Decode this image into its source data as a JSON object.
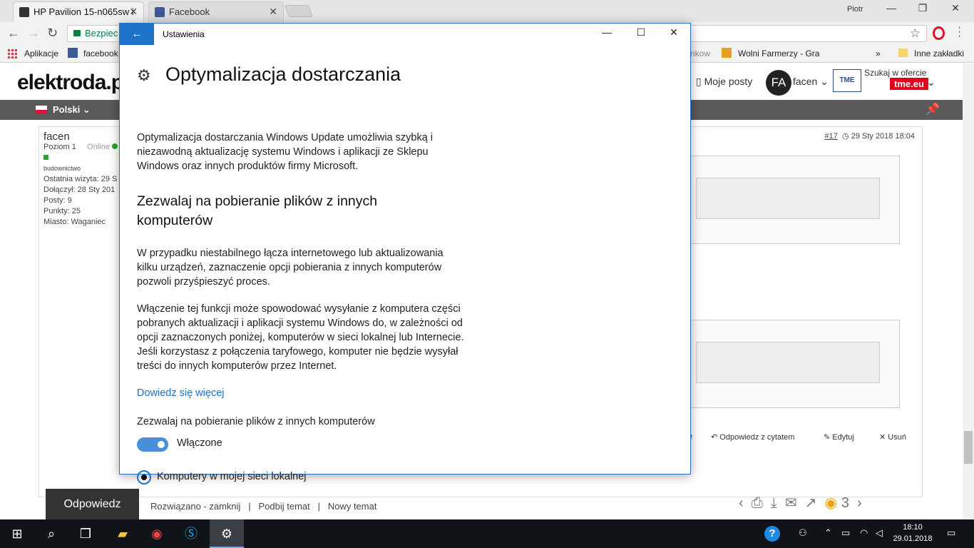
{
  "browser": {
    "tabs": [
      {
        "label": "HP Pavilion 15-n065sw i",
        "favicon_color": "#333333"
      },
      {
        "label": "Facebook",
        "favicon_color": "#3b5998"
      }
    ],
    "window_user": "Piotr",
    "address_secure": "Bezpiec",
    "bookmarks": [
      "Aplikacje",
      "facebook",
      "nkow",
      "Wolni Farmerzy - Gra",
      "Inne zakładki"
    ]
  },
  "site": {
    "logo": "elektroda.p",
    "my_posts": "Moje posty",
    "avatar_initials": "FA",
    "username": "facen",
    "search_offer": "Szukaj w ofercie",
    "tme": "tme.eu",
    "tme_logo": "TME",
    "language": "Polski",
    "post": {
      "author": "facen",
      "level": "Poziom 1",
      "status": "Online",
      "category": "budownictwo",
      "last_visit": "Ostatnia wizyta: 29 S",
      "joined": "Dołączył: 28 Sty 201",
      "posts": "Posty: 9",
      "points": "Punkty: 25",
      "city": "Miasto: Waganiec",
      "number": "#17",
      "date": "29 Sty 2018 18:04"
    },
    "actions": {
      "partial": "e",
      "reply_quote": "Odpowiedz z cytatem",
      "edit": "Edytuj",
      "delete": "Usuń"
    },
    "reply_button": "Odpowiedz",
    "bottom_links": [
      "Rozwiązano - zamknij",
      "Podbij temat",
      "Nowy temat"
    ],
    "watchers": "3"
  },
  "settings": {
    "window_title": "Ustawienia",
    "heading": "Optymalizacja dostarczania",
    "intro": "Optymalizacja dostarczania Windows Update umożliwia szybką i niezawodną aktualizację systemu Windows i aplikacji ze Sklepu Windows oraz innych produktów firmy Microsoft.",
    "subheading": "Zezwalaj na pobieranie plików z innych komputerów",
    "para1": "W przypadku niestabilnego łącza internetowego lub aktualizowania kilku urządzeń, zaznaczenie opcji pobierania z innych komputerów pozwoli przyśpieszyć proces.",
    "para2": "Włączenie tej funkcji może spowodować wysyłanie z komputera części pobranych aktualizacji i aplikacji systemu Windows do, w zależności od opcji zaznaczonych poniżej, komputerów w sieci lokalnej lub Internecie. Jeśli korzystasz z połączenia taryfowego, komputer nie będzie wysyłał treści do innych komputerów przez Internet.",
    "learn_more": "Dowiedz się więcej",
    "toggle_label": "Zezwalaj na pobieranie plików z innych komputerów",
    "toggle_state": "Włączone",
    "toggle_on": true,
    "radio_option": "Komputery w mojej sieci lokalnej",
    "accent_color": "#1e73c8"
  },
  "taskbar": {
    "time": "18:10",
    "date": "29.01.2018"
  }
}
